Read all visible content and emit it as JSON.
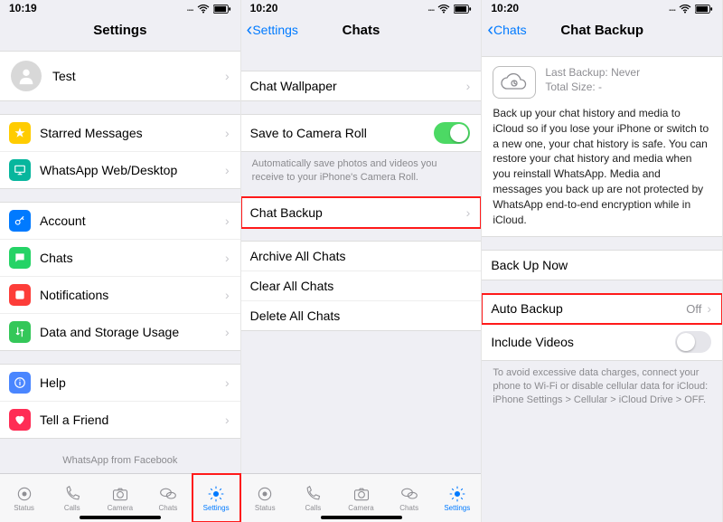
{
  "col1": {
    "time": "10:19",
    "title": "Settings",
    "profile_name": "Test",
    "rows_g1": [
      {
        "label": "Starred Messages",
        "icon": "star",
        "bg": "#ffcc00"
      },
      {
        "label": "WhatsApp Web/Desktop",
        "icon": "monitor",
        "bg": "#07b69d"
      }
    ],
    "rows_g2": [
      {
        "label": "Account",
        "icon": "key",
        "bg": "#007aff"
      },
      {
        "label": "Chats",
        "icon": "chat",
        "bg": "#25d366"
      },
      {
        "label": "Notifications",
        "icon": "bell",
        "bg": "#fd3d39"
      },
      {
        "label": "Data and Storage Usage",
        "icon": "data",
        "bg": "#34c759"
      }
    ],
    "rows_g3": [
      {
        "label": "Help",
        "icon": "info",
        "bg": "#4a86ff"
      },
      {
        "label": "Tell a Friend",
        "icon": "heart",
        "bg": "#ff2d55"
      }
    ],
    "footer": "WhatsApp from Facebook"
  },
  "col2": {
    "time": "10:20",
    "back": "Settings",
    "title": "Chats",
    "row_wallpaper": "Chat Wallpaper",
    "row_camera": "Save to Camera Roll",
    "caption_camera": "Automatically save photos and videos you receive to your iPhone's Camera Roll.",
    "row_backup": "Chat Backup",
    "row_archive": "Archive All Chats",
    "row_clear": "Clear All Chats",
    "row_delete": "Delete All Chats"
  },
  "col3": {
    "time": "10:20",
    "back": "Chats",
    "title": "Chat Backup",
    "last_backup_label": "Last Backup:",
    "last_backup_value": "Never",
    "total_size_label": "Total Size:",
    "total_size_value": "-",
    "desc": "Back up your chat history and media to iCloud so if you lose your iPhone or switch to a new one, your chat history is safe. You can restore your chat history and media when you reinstall WhatsApp. Media and messages you back up are not protected by WhatsApp end-to-end encryption while in iCloud.",
    "backup_now": "Back Up Now",
    "auto_backup_label": "Auto Backup",
    "auto_backup_value": "Off",
    "include_videos": "Include Videos",
    "caption_bottom": "To avoid excessive data charges, connect your phone to Wi-Fi or disable cellular data for iCloud: iPhone Settings > Cellular > iCloud Drive > OFF."
  },
  "tabs": [
    "Status",
    "Calls",
    "Camera",
    "Chats",
    "Settings"
  ]
}
